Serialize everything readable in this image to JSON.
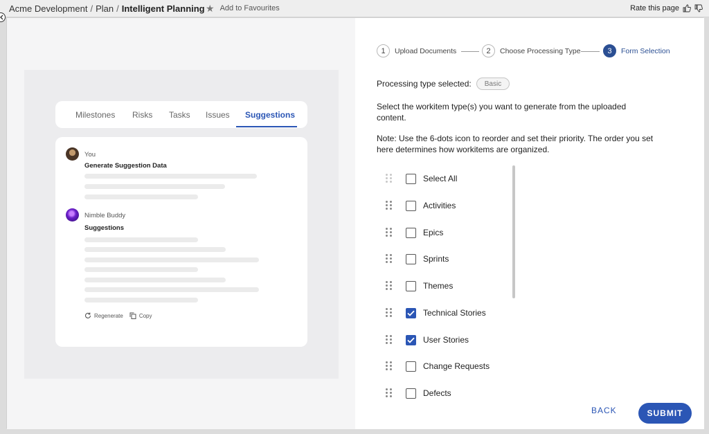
{
  "header": {
    "breadcrumb": [
      "Acme Development",
      "Plan",
      "Intelligent Planning"
    ],
    "favourite_label": "Add to Favourites",
    "rate_label": "Rate this page"
  },
  "preview": {
    "tabs": [
      {
        "label": "Milestones",
        "active": false
      },
      {
        "label": "Risks",
        "active": false
      },
      {
        "label": "Tasks",
        "active": false
      },
      {
        "label": "Issues",
        "active": false
      },
      {
        "label": "Suggestions",
        "active": true
      }
    ],
    "chat": {
      "user_name": "You",
      "user_message": "Generate Suggestion Data",
      "bot_name": "Nimble Buddy",
      "bot_title": "Suggestions",
      "regenerate_label": "Regenerate",
      "copy_label": "Copy"
    }
  },
  "wizard": {
    "steps": [
      {
        "number": "1",
        "label": "Upload Documents",
        "active": false
      },
      {
        "number": "2",
        "label": "Choose Processing Type",
        "active": false
      },
      {
        "number": "3",
        "label": "Form Selection",
        "active": true
      }
    ],
    "processing_label": "Processing type selected:",
    "processing_value": "Basic",
    "instruction": "Select the workitem type(s) you want to generate from the uploaded content.",
    "note": "Note: Use the 6-dots icon to reorder and set their priority. The order you set here determines how workitems are organized.",
    "items": [
      {
        "label": "Select All",
        "checked": false
      },
      {
        "label": "Activities",
        "checked": false
      },
      {
        "label": "Epics",
        "checked": false
      },
      {
        "label": "Sprints",
        "checked": false
      },
      {
        "label": "Themes",
        "checked": false
      },
      {
        "label": "Technical Stories",
        "checked": true
      },
      {
        "label": "User Stories",
        "checked": true
      },
      {
        "label": "Change Requests",
        "checked": false
      },
      {
        "label": "Defects",
        "checked": false
      }
    ],
    "back_label": "BACK",
    "submit_label": "SUBMIT"
  },
  "colors": {
    "accent": "#2b56b5",
    "step_active": "#2b4f93"
  }
}
